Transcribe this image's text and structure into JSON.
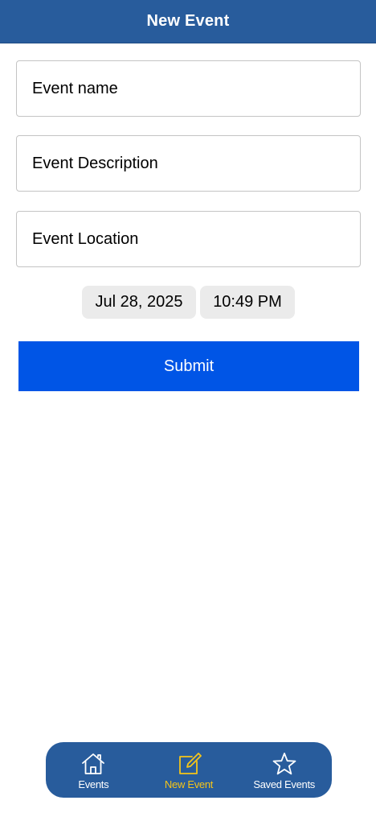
{
  "header": {
    "title": "New Event"
  },
  "form": {
    "name_placeholder": "Event name",
    "description_placeholder": "Event Description",
    "location_placeholder": "Event Location",
    "date_value": "Jul 28, 2025",
    "time_value": "10:49 PM",
    "submit_label": "Submit"
  },
  "tabbar": {
    "active_color": "#f5c518",
    "inactive_color": "#ffffff",
    "items": [
      {
        "label": "Events",
        "icon": "home-icon",
        "active": false
      },
      {
        "label": "New Event",
        "icon": "edit-icon",
        "active": true
      },
      {
        "label": "Saved Events",
        "icon": "star-icon",
        "active": false
      }
    ]
  },
  "colors": {
    "header_bg": "#285c9c",
    "submit_bg": "#0055e6",
    "pill_bg": "#ebebeb"
  }
}
